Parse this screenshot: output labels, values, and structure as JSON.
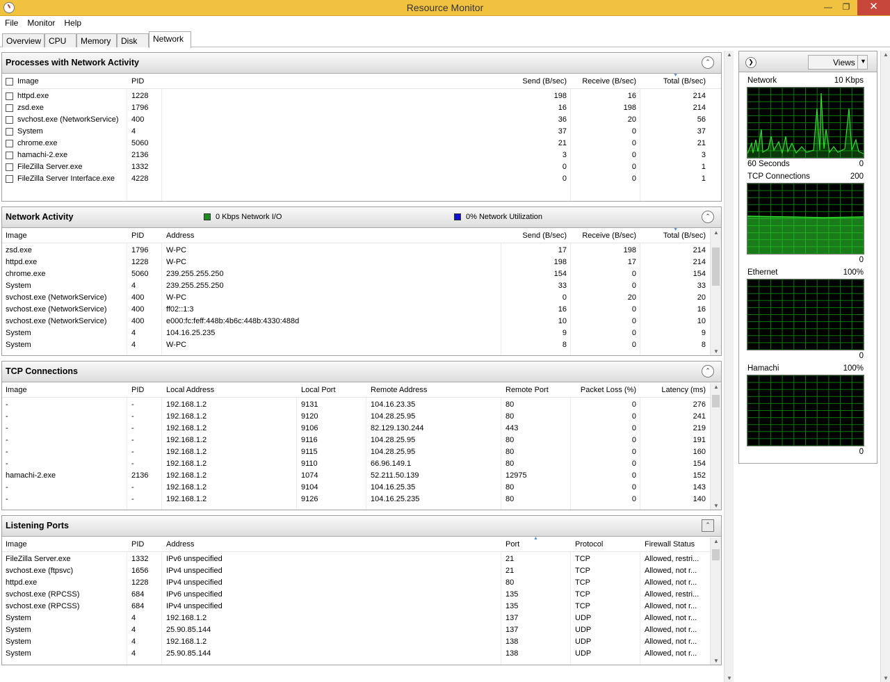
{
  "window": {
    "title": "Resource Monitor"
  },
  "menu": [
    "File",
    "Monitor",
    "Help"
  ],
  "tabs": [
    "Overview",
    "CPU",
    "Memory",
    "Disk",
    "Network"
  ],
  "processes": {
    "title": "Processes with Network Activity",
    "columns": [
      "Image",
      "PID",
      "Send (B/sec)",
      "Receive (B/sec)",
      "Total (B/sec)"
    ],
    "rows": [
      [
        "httpd.exe",
        "1228",
        "198",
        "16",
        "214"
      ],
      [
        "zsd.exe",
        "1796",
        "16",
        "198",
        "214"
      ],
      [
        "svchost.exe (NetworkService)",
        "400",
        "36",
        "20",
        "56"
      ],
      [
        "System",
        "4",
        "37",
        "0",
        "37"
      ],
      [
        "chrome.exe",
        "5060",
        "21",
        "0",
        "21"
      ],
      [
        "hamachi-2.exe",
        "2136",
        "3",
        "0",
        "3"
      ],
      [
        "FileZilla Server.exe",
        "1332",
        "0",
        "0",
        "1"
      ],
      [
        "FileZilla Server Interface.exe",
        "4228",
        "0",
        "0",
        "1"
      ]
    ]
  },
  "activity": {
    "title": "Network Activity",
    "legend_io": "0 Kbps Network I/O",
    "legend_util": "0% Network Utilization",
    "io_color": "#1f8a1f",
    "util_color": "#1010c8",
    "columns": [
      "Image",
      "PID",
      "Address",
      "Send (B/sec)",
      "Receive (B/sec)",
      "Total (B/sec)"
    ],
    "rows": [
      [
        "zsd.exe",
        "1796",
        "W-PC",
        "17",
        "198",
        "214"
      ],
      [
        "httpd.exe",
        "1228",
        "W-PC",
        "198",
        "17",
        "214"
      ],
      [
        "chrome.exe",
        "5060",
        "239.255.255.250",
        "154",
        "0",
        "154"
      ],
      [
        "System",
        "4",
        "239.255.255.250",
        "33",
        "0",
        "33"
      ],
      [
        "svchost.exe (NetworkService)",
        "400",
        "W-PC",
        "0",
        "20",
        "20"
      ],
      [
        "svchost.exe (NetworkService)",
        "400",
        "ff02::1:3",
        "16",
        "0",
        "16"
      ],
      [
        "svchost.exe (NetworkService)",
        "400",
        "e000:fc:feff:448b:4b6c:448b:4330:488d",
        "10",
        "0",
        "10"
      ],
      [
        "System",
        "4",
        "104.16.25.235",
        "9",
        "0",
        "9"
      ],
      [
        "System",
        "4",
        "W-PC",
        "8",
        "0",
        "8"
      ]
    ]
  },
  "tcp": {
    "title": "TCP Connections",
    "columns": [
      "Image",
      "PID",
      "Local Address",
      "Local Port",
      "Remote Address",
      "Remote Port",
      "Packet Loss (%)",
      "Latency (ms)"
    ],
    "rows": [
      [
        "-",
        "-",
        "192.168.1.2",
        "9131",
        "104.16.23.35",
        "80",
        "0",
        "276"
      ],
      [
        "-",
        "-",
        "192.168.1.2",
        "9120",
        "104.28.25.95",
        "80",
        "0",
        "241"
      ],
      [
        "-",
        "-",
        "192.168.1.2",
        "9106",
        "82.129.130.244",
        "443",
        "0",
        "219"
      ],
      [
        "-",
        "-",
        "192.168.1.2",
        "9116",
        "104.28.25.95",
        "80",
        "0",
        "191"
      ],
      [
        "-",
        "-",
        "192.168.1.2",
        "9115",
        "104.28.25.95",
        "80",
        "0",
        "160"
      ],
      [
        "-",
        "-",
        "192.168.1.2",
        "9110",
        "66.96.149.1",
        "80",
        "0",
        "154"
      ],
      [
        "hamachi-2.exe",
        "2136",
        "192.168.1.2",
        "1074",
        "52.211.50.139",
        "12975",
        "0",
        "152"
      ],
      [
        "-",
        "-",
        "192.168.1.2",
        "9104",
        "104.16.25.35",
        "80",
        "0",
        "143"
      ],
      [
        "-",
        "-",
        "192.168.1.2",
        "9126",
        "104.16.25.235",
        "80",
        "0",
        "140"
      ]
    ]
  },
  "listening": {
    "title": "Listening Ports",
    "columns": [
      "Image",
      "PID",
      "Address",
      "Port",
      "Protocol",
      "Firewall Status"
    ],
    "rows": [
      [
        "FileZilla Server.exe",
        "1332",
        "IPv6 unspecified",
        "21",
        "TCP",
        "Allowed, restri..."
      ],
      [
        "svchost.exe (ftpsvc)",
        "1656",
        "IPv4 unspecified",
        "21",
        "TCP",
        "Allowed, not r..."
      ],
      [
        "httpd.exe",
        "1228",
        "IPv4 unspecified",
        "80",
        "TCP",
        "Allowed, not r..."
      ],
      [
        "svchost.exe (RPCSS)",
        "684",
        "IPv6 unspecified",
        "135",
        "TCP",
        "Allowed, restri..."
      ],
      [
        "svchost.exe (RPCSS)",
        "684",
        "IPv4 unspecified",
        "135",
        "TCP",
        "Allowed, not r..."
      ],
      [
        "System",
        "4",
        "192.168.1.2",
        "137",
        "UDP",
        "Allowed, not r..."
      ],
      [
        "System",
        "4",
        "25.90.85.144",
        "137",
        "UDP",
        "Allowed, not r..."
      ],
      [
        "System",
        "4",
        "192.168.1.2",
        "138",
        "UDP",
        "Allowed, not r..."
      ],
      [
        "System",
        "4",
        "25.90.85.144",
        "138",
        "UDP",
        "Allowed, not r..."
      ]
    ]
  },
  "sidebar": {
    "views_label": "Views",
    "graphs": [
      {
        "name": "Network",
        "max": "10 Kbps",
        "footer_left": "60 Seconds",
        "footer_right": "0"
      },
      {
        "name": "TCP Connections",
        "max": "200",
        "footer_left": "",
        "footer_right": "0"
      },
      {
        "name": "Ethernet",
        "max": "100%",
        "footer_left": "",
        "footer_right": "0"
      },
      {
        "name": "Hamachi",
        "max": "100%",
        "footer_left": "",
        "footer_right": "0"
      }
    ],
    "grid_color": "#0a7a0a",
    "line_color": "#2ee02e"
  }
}
